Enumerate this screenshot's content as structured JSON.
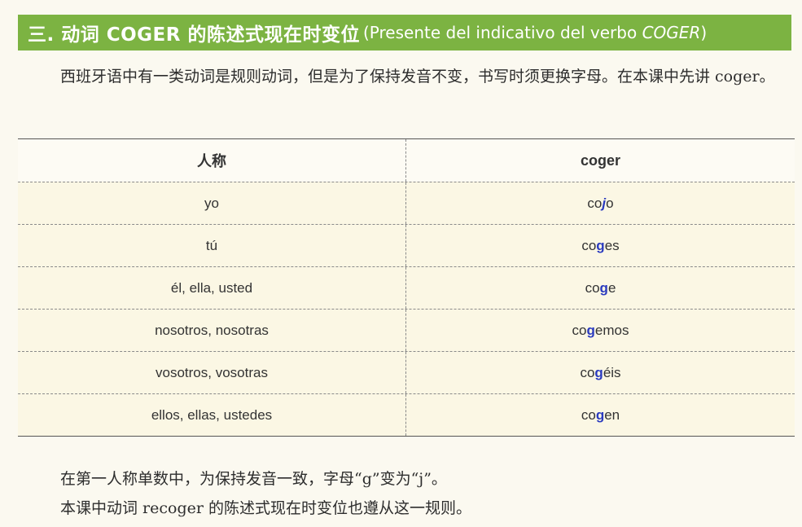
{
  "header": {
    "title_zh": "三. 动词 COGER 的陈述式现在时变位",
    "subtitle_open": "(Presente del indicativo del verbo ",
    "subtitle_verb": "COGER",
    "subtitle_close": ")",
    "bg_color": "#7cb342"
  },
  "intro": "西班牙语中有一类动词是规则动词，但是为了保持发音不变，书写时须更换字母。在本课中先讲 coger。",
  "table": {
    "headers": [
      "人称",
      "coger"
    ],
    "highlight_color": "#2b3bbf",
    "rows": [
      {
        "person": "yo",
        "pre": "co",
        "hl": "j",
        "post": "o",
        "italic": true
      },
      {
        "person": "tú",
        "pre": "co",
        "hl": "g",
        "post": "es",
        "italic": false
      },
      {
        "person": "él, ella, usted",
        "pre": "co",
        "hl": "g",
        "post": "e",
        "italic": false
      },
      {
        "person": "nosotros, nosotras",
        "pre": "co",
        "hl": "g",
        "post": "emos",
        "italic": false
      },
      {
        "person": "vosotros, vosotras",
        "pre": "co",
        "hl": "g",
        "post": "éis",
        "italic": false
      },
      {
        "person": "ellos, ellas, ustedes",
        "pre": "co",
        "hl": "g",
        "post": "en",
        "italic": false
      }
    ]
  },
  "notes": [
    "在第一人称单数中，为保持发音一致，字母“g”变为“j”。",
    "本课中动词 recoger 的陈述式现在时变位也遵从这一规则。"
  ]
}
